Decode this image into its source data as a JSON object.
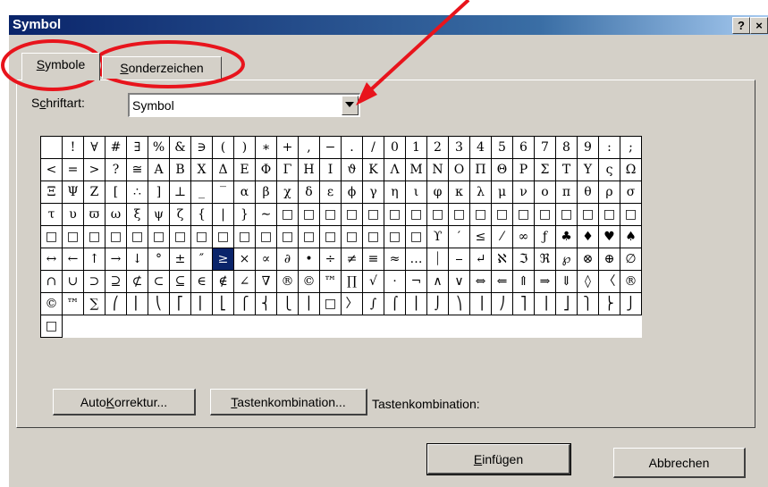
{
  "window": {
    "title": "Symbol",
    "help_button": "?",
    "close_button": "×"
  },
  "tabs": [
    {
      "label_pre": "",
      "label_u": "S",
      "label_post": "ymbole",
      "active": true
    },
    {
      "label_pre": "",
      "label_u": "S",
      "label_post": "onderzeichen",
      "active": false
    }
  ],
  "font_field": {
    "label_pre": "S",
    "label_u": "c",
    "label_post": "hriftart:",
    "value": "Symbol"
  },
  "symbol_grid": {
    "selected_index": 148,
    "cells": [
      "",
      "!",
      "∀",
      "#",
      "∃",
      "%",
      "&",
      "∋",
      "(",
      ")",
      "∗",
      "+",
      ",",
      "−",
      ".",
      "/",
      "0",
      "1",
      "2",
      "3",
      "4",
      "5",
      "6",
      "7",
      "8",
      "9",
      ":",
      ";",
      "<",
      "=",
      ">",
      "?",
      "≅",
      "Α",
      "Β",
      "Χ",
      "Δ",
      "Ε",
      "Φ",
      "Γ",
      "Η",
      "Ι",
      "ϑ",
      "Κ",
      "Λ",
      "Μ",
      "Ν",
      "Ο",
      "Π",
      "Θ",
      "Ρ",
      "Σ",
      "Τ",
      "Υ",
      "ς",
      "Ω",
      "Ξ",
      "Ψ",
      "Ζ",
      "[",
      "∴",
      "]",
      "⊥",
      "_",
      "‾",
      "α",
      "β",
      "χ",
      "δ",
      "ε",
      "ϕ",
      "γ",
      "η",
      "ι",
      "φ",
      "κ",
      "λ",
      "μ",
      "ν",
      "ο",
      "π",
      "θ",
      "ρ",
      "σ",
      "τ",
      "υ",
      "ϖ",
      "ω",
      "ξ",
      "ψ",
      "ζ",
      "{",
      "|",
      "}",
      "∼",
      "□",
      "□",
      "□",
      "□",
      "□",
      "□",
      "□",
      "□",
      "□",
      "□",
      "□",
      "□",
      "□",
      "□",
      "□",
      "□",
      "□",
      "□",
      "□",
      "□",
      "□",
      "□",
      "□",
      "□",
      "□",
      "□",
      "□",
      "□",
      "□",
      "□",
      "□",
      "□",
      "□",
      "□",
      "□",
      "ϒ",
      "′",
      "≤",
      "⁄",
      "∞",
      "ƒ",
      "♣",
      "♦",
      "♥",
      "♠",
      "↔",
      "←",
      "↑",
      "→",
      "↓",
      "°",
      "±",
      "″",
      "≥",
      "×",
      "∝",
      "∂",
      "•",
      "÷",
      "≠",
      "≡",
      "≈",
      "…",
      "⏐",
      "⎯",
      "↵",
      "ℵ",
      "ℑ",
      "ℜ",
      "℘",
      "⊗",
      "⊕",
      "∅",
      "∩",
      "∪",
      "⊃",
      "⊇",
      "⊄",
      "⊂",
      "⊆",
      "∈",
      "∉",
      "∠",
      "∇",
      "®",
      "©",
      "™",
      "∏",
      "√",
      "⋅",
      "¬",
      "∧",
      "∨",
      "⇔",
      "⇐",
      "⇑",
      "⇒",
      "⇓",
      "◊",
      "〈",
      "®",
      "©",
      "™",
      "∑",
      "⎛",
      "⎜",
      "⎝",
      "⎡",
      "⎢",
      "⎣",
      "⎧",
      "⎨",
      "⎩",
      "⎪",
      "□",
      "〉",
      "∫",
      "⌠",
      "⎮",
      "⌡",
      "⎞",
      "⎟",
      "⎠",
      "⎤",
      "⎥",
      "⎦",
      "⎫",
      "⎬",
      "⎭",
      "□"
    ]
  },
  "buttons": {
    "autokorrektur": {
      "pre": "Auto",
      "u": "K",
      "post": "orrektur..."
    },
    "tastenkombination": {
      "pre": "",
      "u": "T",
      "post": "astenkombination..."
    },
    "shortcut_label": "Tastenkombination:",
    "einfuegen": {
      "pre": "",
      "u": "E",
      "post": "infügen"
    },
    "abbrechen": "Abbrechen"
  },
  "annotation_color": "#e8141c"
}
